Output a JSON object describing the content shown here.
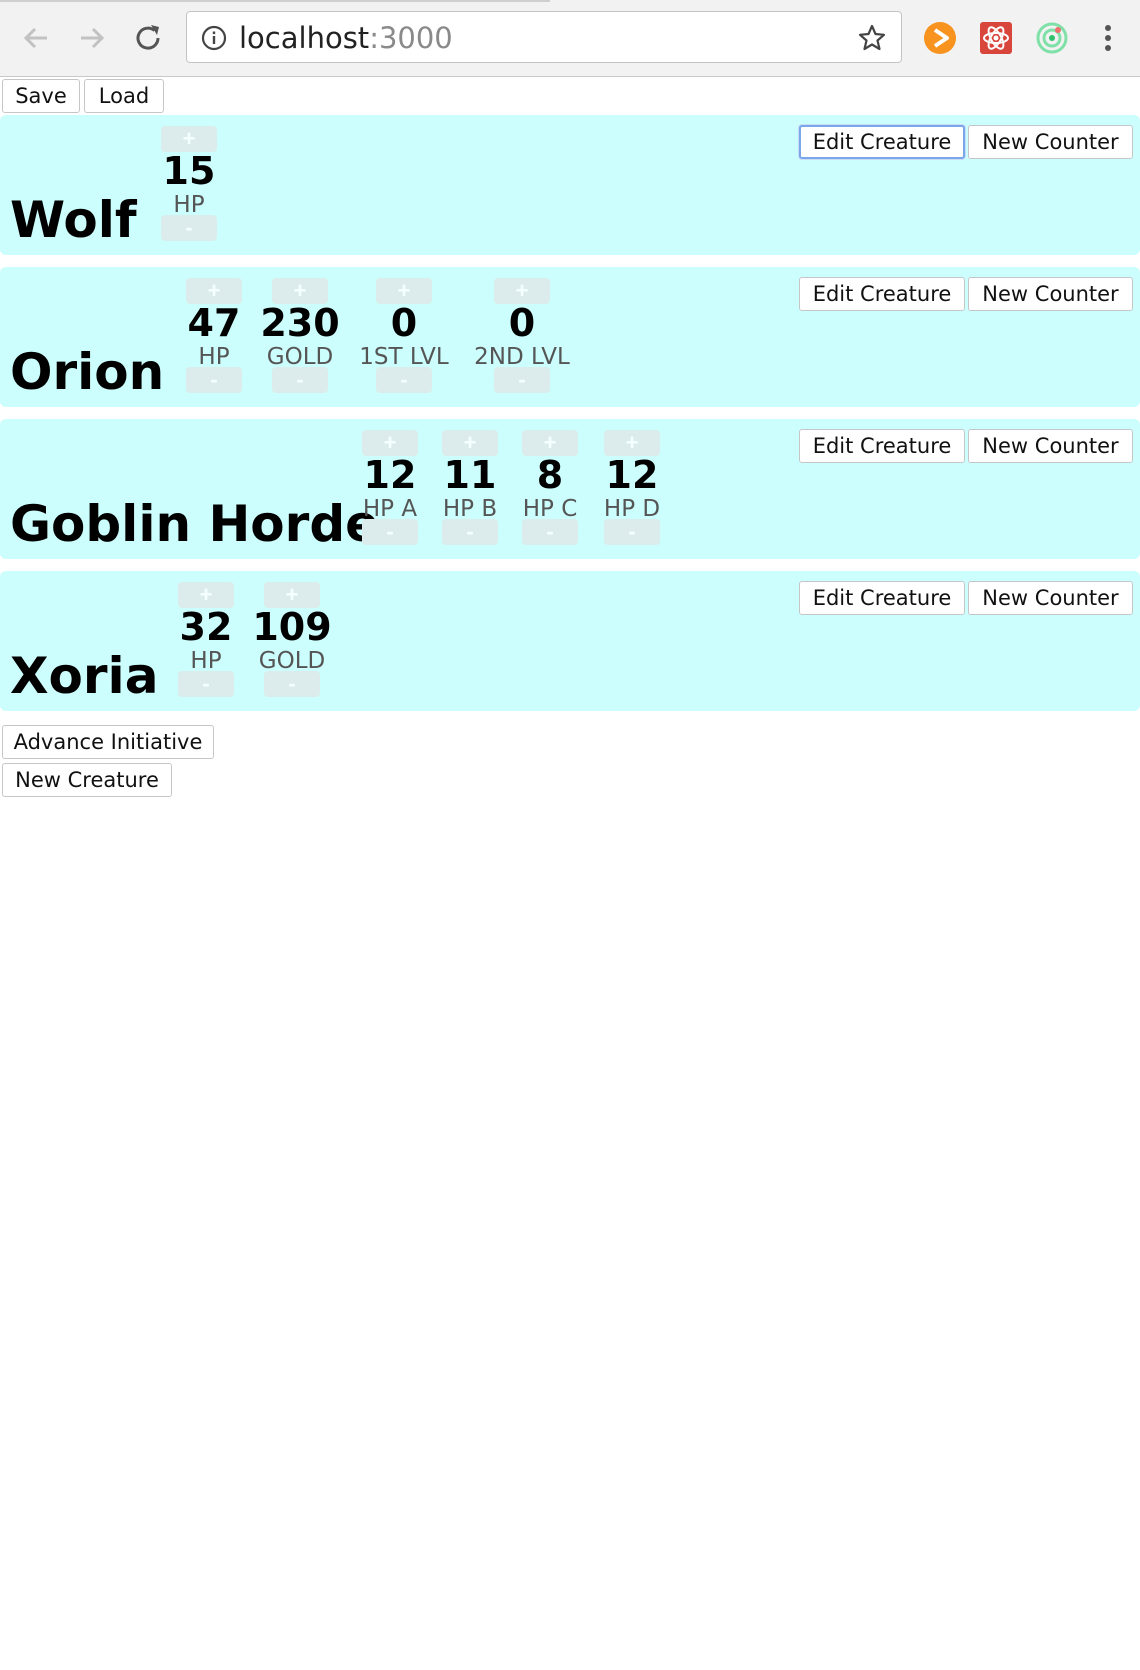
{
  "browser": {
    "url_host": "localhost",
    "url_port": ":3000"
  },
  "toolbar": {
    "save_label": "Save",
    "load_label": "Load"
  },
  "creature_buttons": {
    "edit_label": "Edit Creature",
    "new_counter_label": "New Counter"
  },
  "counter_controls": {
    "plus": "+",
    "minus": "-"
  },
  "creatures": [
    {
      "name": "Wolf",
      "counters": [
        {
          "value": "15",
          "label": "HP"
        }
      ]
    },
    {
      "name": "Orion",
      "counters": [
        {
          "value": "47",
          "label": "HP"
        },
        {
          "value": "230",
          "label": "GOLD"
        },
        {
          "value": "0",
          "label": "1ST LVL"
        },
        {
          "value": "0",
          "label": "2ND LVL"
        }
      ]
    },
    {
      "name": "Goblin Horde",
      "counters": [
        {
          "value": "12",
          "label": "HP A"
        },
        {
          "value": "11",
          "label": "HP B"
        },
        {
          "value": "8",
          "label": "HP C"
        },
        {
          "value": "12",
          "label": "HP D"
        }
      ]
    },
    {
      "name": "Xoria",
      "counters": [
        {
          "value": "32",
          "label": "HP"
        },
        {
          "value": "109",
          "label": "GOLD"
        }
      ]
    }
  ],
  "footer": {
    "advance_label": "Advance Initiative",
    "new_creature_label": "New Creature"
  },
  "colors": {
    "creature_bg": "#ccfefd",
    "counter_button_bg": "#dcecec"
  }
}
